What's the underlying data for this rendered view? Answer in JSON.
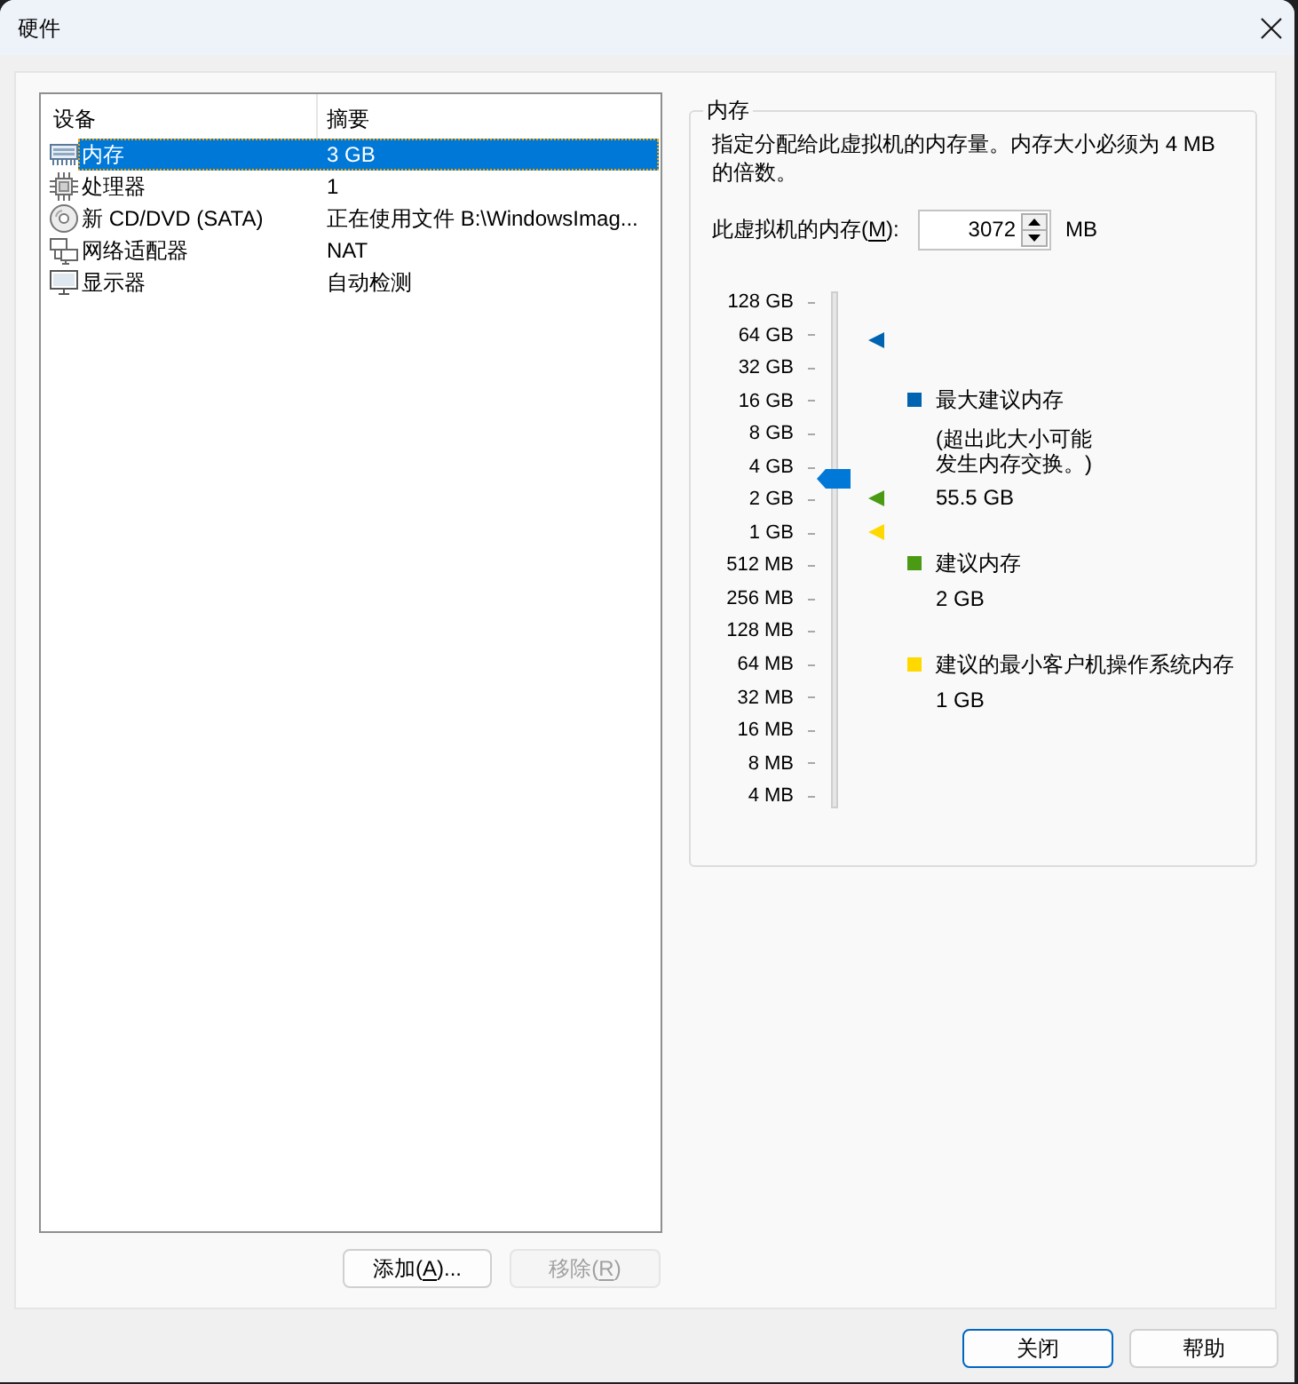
{
  "window": {
    "title": "硬件"
  },
  "device_list": {
    "columns": [
      "设备",
      "摘要"
    ],
    "rows": [
      {
        "kind": "memory",
        "name": "内存",
        "summary": "3 GB",
        "selected": true
      },
      {
        "kind": "processor",
        "name": "处理器",
        "summary": "1",
        "selected": false
      },
      {
        "kind": "cd",
        "name": "新 CD/DVD (SATA)",
        "summary": "正在使用文件 B:\\WindowsImag...",
        "selected": false
      },
      {
        "kind": "network",
        "name": "网络适配器",
        "summary": "NAT",
        "selected": false
      },
      {
        "kind": "display",
        "name": "显示器",
        "summary": "自动检测",
        "selected": false
      }
    ]
  },
  "list_buttons": [
    {
      "before": "添加(",
      "access_key": "A",
      "after": ")...",
      "disabled": false
    },
    {
      "before": "移除(",
      "access_key": "R",
      "after": ")",
      "disabled": true
    }
  ],
  "memory": {
    "title": "内存",
    "description": "指定分配给此虚拟机的内存量。内存大小必须为 4 MB\n的倍数。",
    "field_label": {
      "before": "此虚拟机的内存(",
      "access_key": "M",
      "after": "):"
    },
    "value": "3072",
    "unit": "MB",
    "slider": {
      "level": 0.638,
      "scale": [
        "128 GB",
        "64 GB",
        "32 GB",
        "16 GB",
        "8 GB",
        "4 GB",
        "2 GB",
        "1 GB",
        "512 MB",
        "256 MB",
        "128 MB",
        "64 MB",
        "32 MB",
        "16 MB",
        "8 MB",
        "4 MB"
      ],
      "markers": [
        {
          "color": "#0063b1",
          "level": 0.906
        },
        {
          "color": "#4b9a14",
          "level": 0.599
        },
        {
          "color": "#ffd800",
          "level": 0.534
        }
      ]
    },
    "legend": [
      {
        "color": "#0063b1",
        "label": "最大建议内存",
        "note": "(超出此大小可能发生内存交换。)",
        "value": "55.5 GB"
      },
      {
        "color": "#4b9a14",
        "label": "建议内存",
        "value": "2 GB"
      },
      {
        "color": "#ffd800",
        "label": "建议的最小客户机操作系统内存",
        "value": "1 GB"
      }
    ]
  },
  "dialog_buttons": [
    {
      "label": "关闭",
      "default": true
    },
    {
      "label": "帮助",
      "default": false
    }
  ]
}
